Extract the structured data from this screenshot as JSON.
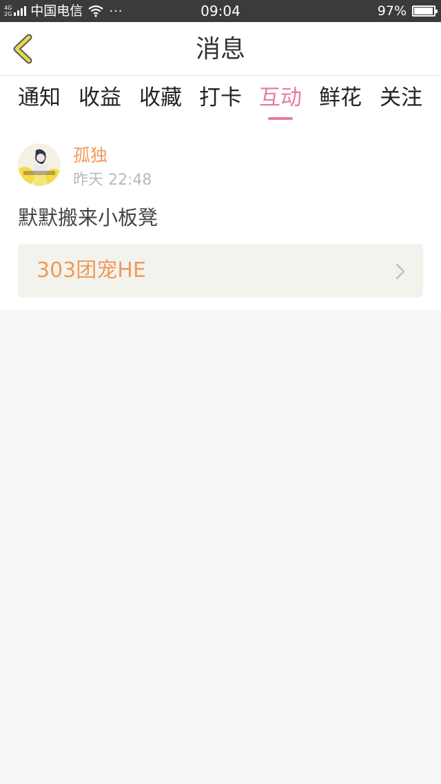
{
  "status_bar": {
    "network_top": "4G",
    "network_bottom": "2G",
    "carrier": "中国电信",
    "more": "···",
    "time": "09:04",
    "battery_percent": "97%",
    "battery_level": 0.97
  },
  "nav": {
    "title": "消息",
    "back_icon": "chevron-left-icon",
    "accent_color": "#e8d54a"
  },
  "tabs": [
    {
      "label": "通知",
      "active": false
    },
    {
      "label": "收益",
      "active": false
    },
    {
      "label": "收藏",
      "active": false
    },
    {
      "label": "打卡",
      "active": false
    },
    {
      "label": "互动",
      "active": true
    },
    {
      "label": "鲜花",
      "active": false
    },
    {
      "label": "关注",
      "active": false
    }
  ],
  "active_tab_color": "#e87aa8",
  "item": {
    "username": "孤独",
    "time": "昨天 22:48",
    "message": "默默搬来小板凳",
    "link_title": "303团宠HE",
    "link_icon": "chevron-right-icon"
  },
  "colors": {
    "username": "#f09a5a",
    "link": "#f09a5a",
    "status_bar_bg": "#3b3b3b"
  }
}
